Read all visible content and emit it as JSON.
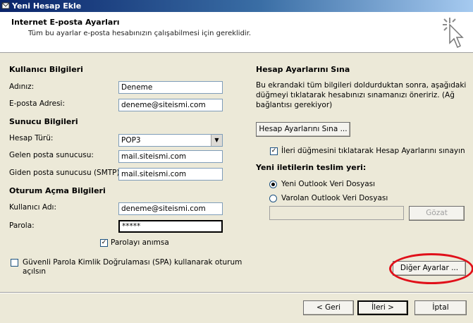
{
  "window": {
    "title": "Yeni Hesap Ekle"
  },
  "header": {
    "title": "Internet E-posta Ayarları",
    "subtitle": "Tüm bu ayarlar e-posta hesabınızın çalışabilmesi için gereklidir."
  },
  "user_info": {
    "heading": "Kullanıcı Bilgileri",
    "name_label": "Adınız:",
    "name_value": "Deneme",
    "email_label": "E-posta Adresi:",
    "email_value": "deneme@siteismi.com"
  },
  "server_info": {
    "heading": "Sunucu Bilgileri",
    "account_type_label": "Hesap Türü:",
    "account_type_value": "POP3",
    "incoming_label": "Gelen posta sunucusu:",
    "incoming_value": "mail.siteismi.com",
    "outgoing_label": "Giden posta sunucusu (SMTP):",
    "outgoing_value": "mail.siteismi.com"
  },
  "logon_info": {
    "heading": "Oturum Açma Bilgileri",
    "username_label": "Kullanıcı Adı:",
    "username_value": "deneme@siteismi.com",
    "password_label": "Parola:",
    "password_value": "*****",
    "remember_label": "Parolayı anımsa",
    "remember_checked": true,
    "spa_label_line1": "Güvenli Parola Kimlik Doğrulaması (SPA) kullanarak oturum",
    "spa_label_line2": "açılsın",
    "spa_checked": false
  },
  "test_settings": {
    "heading": "Hesap Ayarlarını Sına",
    "desc_line1": "Bu ekrandaki tüm bilgileri doldurduktan sonra, aşağıdaki",
    "desc_line2": "düğmeyi tıklatarak hesabınızı sınamanızı öneririz. (Ağ",
    "desc_line3": "bağlantısı gerekiyor)",
    "test_button": "Hesap Ayarlarını Sına ...",
    "auto_test_label": "İleri düğmesini tıklatarak Hesap Ayarlarını sınayın",
    "auto_test_checked": true
  },
  "delivery": {
    "heading": "Yeni iletilerin teslim yeri:",
    "new_pst_label": "Yeni Outlook Veri Dosyası",
    "existing_pst_label": "Varolan Outlook Veri Dosyası",
    "path_value": "",
    "browse_button": "Gözat"
  },
  "more_settings_button": "Diğer Ayarlar ...",
  "footer": {
    "back": "< Geri",
    "next": "İleri >",
    "cancel": "İptal"
  },
  "colors": {
    "highlight_oval": "#e0101a"
  }
}
